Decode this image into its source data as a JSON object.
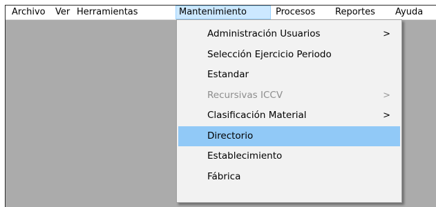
{
  "menubar": {
    "items": [
      {
        "label": "Archivo"
      },
      {
        "label": "Ver"
      },
      {
        "label": "Herramientas"
      },
      {
        "label": "Mantenimiento",
        "active": true
      },
      {
        "label": "Procesos"
      },
      {
        "label": "Reportes"
      },
      {
        "label": "Ayuda"
      }
    ]
  },
  "mantenimiento_menu": {
    "items": [
      {
        "label": "Administración Usuarios",
        "submenu": true,
        "arrow": ">",
        "enabled": true
      },
      {
        "label": "Selección Ejercicio Periodo",
        "submenu": false,
        "enabled": true
      },
      {
        "label": "Estandar",
        "submenu": false,
        "enabled": true
      },
      {
        "label": "Recursivas ICCV",
        "submenu": true,
        "arrow": ">",
        "enabled": false
      },
      {
        "label": "Clasificación Material",
        "submenu": true,
        "arrow": ">",
        "enabled": true
      },
      {
        "label": "Directorio",
        "submenu": false,
        "enabled": true,
        "highlighted": true
      },
      {
        "label": "Establecimiento",
        "submenu": false,
        "enabled": true
      },
      {
        "label": "Fábrica",
        "submenu": false,
        "enabled": true
      }
    ]
  },
  "colors": {
    "workspace": "#ababab",
    "menu_background": "#f2f2f2",
    "highlight": "#91c9f7",
    "active_menubar": "#cce8ff",
    "disabled_text": "#8d8d8d"
  }
}
